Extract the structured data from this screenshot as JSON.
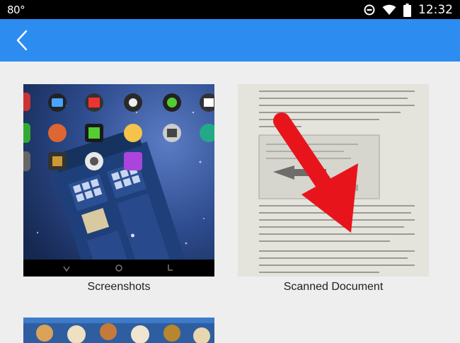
{
  "status_bar": {
    "left_text": "80°",
    "time": "12:32",
    "icons": [
      "do-not-disturb-icon",
      "wifi-icon",
      "battery-icon"
    ]
  },
  "app_bar": {
    "color": "#2d8cf0",
    "back_icon": "chevron-left-icon"
  },
  "albums": [
    {
      "label": "Screenshots"
    },
    {
      "label": "Scanned Document"
    },
    {
      "label": ""
    }
  ],
  "annotation": {
    "icon": "red-arrow-icon",
    "color": "#e8141c"
  }
}
